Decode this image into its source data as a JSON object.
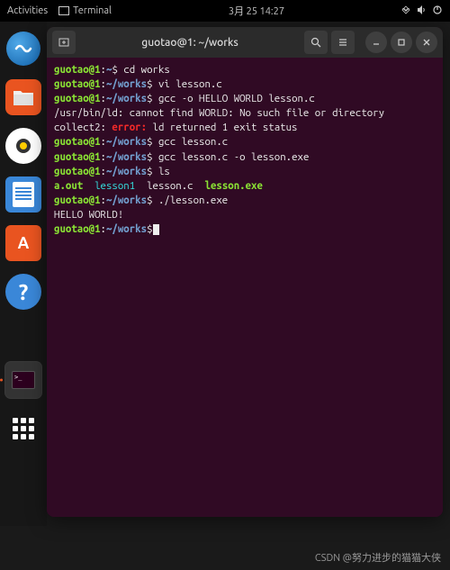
{
  "topbar": {
    "activities": "Activities",
    "terminal_label": "Terminal",
    "datetime": "3月 25  14:27"
  },
  "dock": {
    "items": [
      "blue-app",
      "files",
      "music",
      "docs",
      "software",
      "help",
      "terminal-empty",
      "terminal-active",
      "apps-grid"
    ]
  },
  "window": {
    "title": "guotao@1: ~/works"
  },
  "terminal": {
    "lines": [
      {
        "user": "guotao@1",
        "sep": ":",
        "path": "~",
        "sym": "$",
        "cmd": " cd works"
      },
      {
        "user": "guotao@1",
        "sep": ":",
        "path": "~/works",
        "sym": "$",
        "cmd": " vi lesson.c"
      },
      {
        "user": "guotao@1",
        "sep": ":",
        "path": "~/works",
        "sym": "$",
        "cmd": " gcc -o HELLO WORLD lesson.c"
      },
      {
        "plain": "/usr/bin/ld: cannot find WORLD: No such file or directory"
      },
      {
        "err1": "collect2: ",
        "err2": "error: ",
        "err3": "ld returned 1 exit status"
      },
      {
        "user": "guotao@1",
        "sep": ":",
        "path": "~/works",
        "sym": "$",
        "cmd": " gcc lesson.c"
      },
      {
        "user": "guotao@1",
        "sep": ":",
        "path": "~/works",
        "sym": "$",
        "cmd": " gcc lesson.c -o lesson.exe"
      },
      {
        "user": "guotao@1",
        "sep": ":",
        "path": "~/works",
        "sym": "$",
        "cmd": " ls"
      },
      {
        "ls": true,
        "f1": "a.out",
        "f2": "lesson1",
        "f3": "lesson.c",
        "f4": "lesson.exe"
      },
      {
        "user": "guotao@1",
        "sep": ":",
        "path": "~/works",
        "sym": "$",
        "cmd": " ./lesson.exe"
      },
      {
        "plain": "HELLO WORLD!"
      },
      {
        "user": "guotao@1",
        "sep": ":",
        "path": "~/works",
        "sym": "$",
        "cmd": "",
        "cursor": true
      }
    ]
  },
  "watermark": "CSDN @努力进步的猫猫大侠"
}
